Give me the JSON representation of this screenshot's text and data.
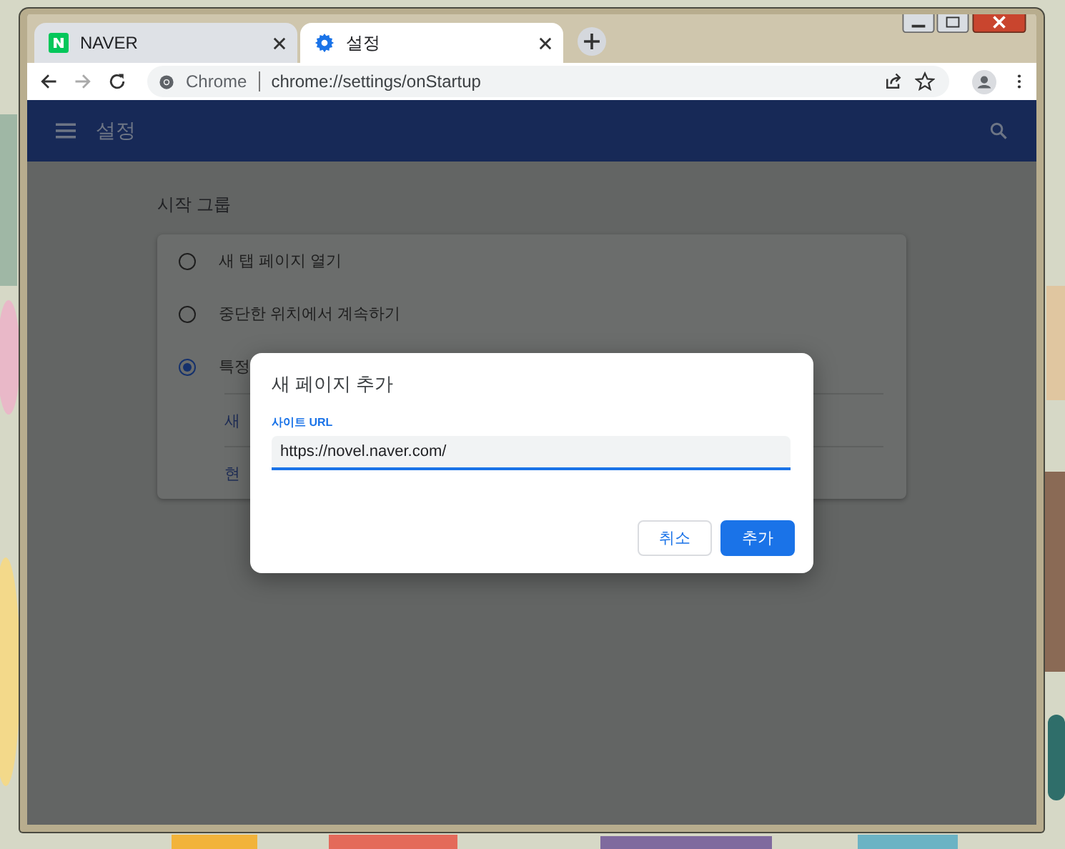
{
  "tabs": [
    {
      "label": "NAVER",
      "selected": false,
      "kind": "naver"
    },
    {
      "label": "설정",
      "selected": true,
      "kind": "gear"
    }
  ],
  "address_bar": {
    "chip": "Chrome",
    "url": "chrome://settings/onStartup"
  },
  "header": {
    "title": "설정"
  },
  "section": {
    "title": "시작 그룹",
    "options": [
      {
        "label": "새 탭 페이지 열기",
        "selected": false
      },
      {
        "label": "중단한 위치에서 계속하기",
        "selected": false
      },
      {
        "label": "특정",
        "selected": true
      }
    ],
    "links": [
      "새",
      "현"
    ]
  },
  "dialog": {
    "title": "새 페이지 추가",
    "field_label": "사이트 URL",
    "value": "https://novel.naver.com/",
    "buttons": [
      {
        "label": "취소",
        "kind": "secondary"
      },
      {
        "label": "추가",
        "kind": "primary"
      }
    ]
  }
}
